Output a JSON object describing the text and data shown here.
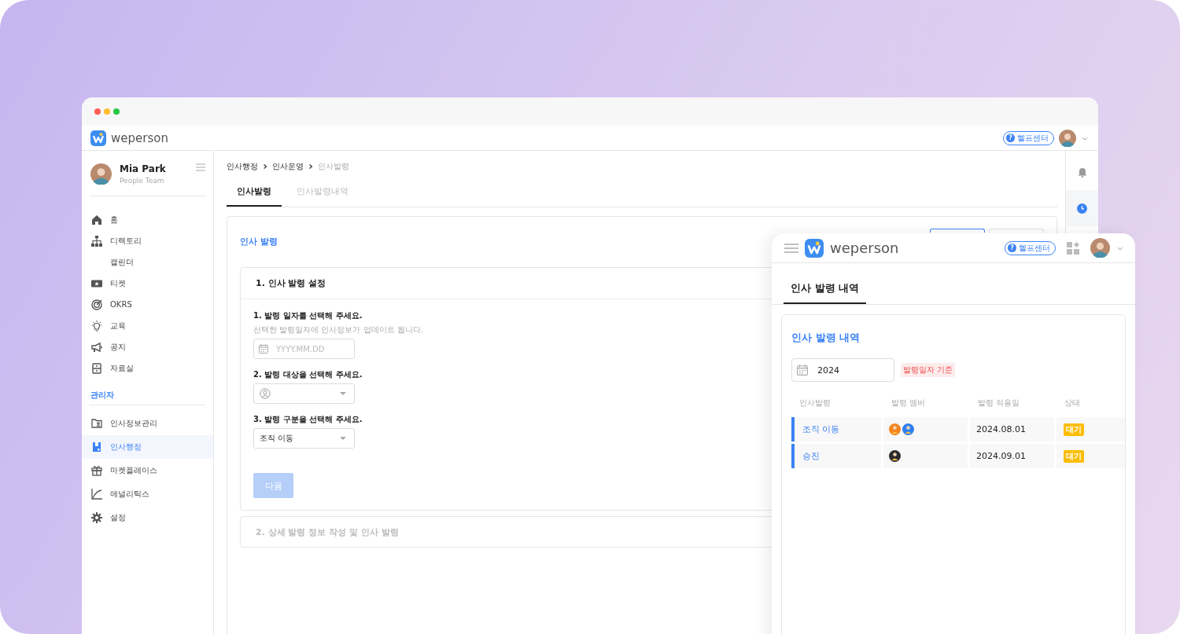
{
  "main_window": {
    "header": {
      "logo": "weperson",
      "help_icon": "?",
      "help": "헬프센터"
    },
    "profile": {
      "name": "Mia Park",
      "team": "People Team"
    },
    "nav": [
      {
        "label": "홈",
        "selected": false
      },
      {
        "label": "디렉토리",
        "selected": false
      },
      {
        "label": "캘린더",
        "selected": false
      },
      {
        "label": "티켓",
        "selected": false
      },
      {
        "label": "OKRS",
        "selected": false
      },
      {
        "label": "교육",
        "selected": false
      },
      {
        "label": "공지",
        "selected": false
      },
      {
        "label": "자료실",
        "selected": false
      }
    ],
    "admin_heading": "관리자",
    "admin_nav": [
      {
        "label": "인사정보관리",
        "selected": false
      },
      {
        "label": "인사행정",
        "selected": true
      },
      {
        "label": "마켓플레이스",
        "selected": false
      },
      {
        "label": "애널리틱스",
        "selected": false
      },
      {
        "label": "설정",
        "selected": false
      }
    ],
    "breadcrumb": [
      "인사행정",
      "인사운영",
      "인사발령"
    ],
    "tabs": [
      {
        "label": "인사발령",
        "selected": true
      },
      {
        "label": "인사발령내역",
        "selected": false
      }
    ],
    "card_title": "인사 발령",
    "step1": {
      "title": "1. 인사 발령 설정",
      "fields": [
        {
          "kind": "date",
          "label": "1. 발령 일자를 선택해 주세요.",
          "hint": "선택한 발령일자에 인사정보가 업데이트 됩니다.",
          "placeholder": "YYYY.MM.DD"
        },
        {
          "kind": "person",
          "label": "2. 발령 대상을 선택해 주세요."
        },
        {
          "kind": "select",
          "label": "3. 발령 구분을 선택해 주세요.",
          "value": "조직 이동"
        }
      ],
      "next_button": {
        "label": "다음",
        "disabled": true
      }
    },
    "step2": {
      "title": "2. 상세 발령 정보 작성 및 인사 발령",
      "disabled": true
    },
    "rail": [
      {
        "selected": false
      },
      {
        "selected": true
      }
    ]
  },
  "history_window": {
    "header": {
      "logo": "weperson",
      "help_icon": "?",
      "help": "헬프센터"
    },
    "tabs": [
      {
        "label": "인사 발령 내역",
        "selected": true
      }
    ],
    "card_title": "인사 발령 내역",
    "year": "2024",
    "filter_tag": "발령일자 기준",
    "columns": [
      "인사발령",
      "발령 멤버",
      "발령 적용일",
      "상태"
    ],
    "rows": [
      {
        "type": "조직 이동",
        "members": [
          {
            "color": "#f5841f"
          },
          {
            "color": "#2f80ed"
          }
        ],
        "date": "2024.08.01",
        "status": "대기"
      },
      {
        "type": "승진",
        "members": [
          {
            "color": "#2b2b2b"
          }
        ],
        "date": "2024.09.01",
        "status": "대기"
      }
    ]
  }
}
